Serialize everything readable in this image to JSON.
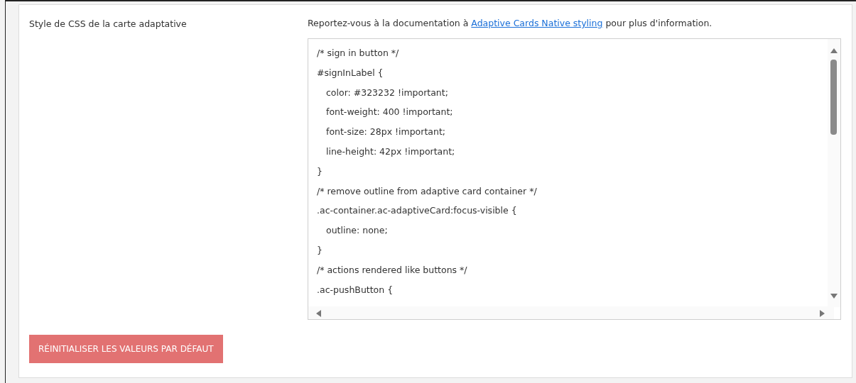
{
  "setting": {
    "label": "Style de CSS de la carte adaptative",
    "help": {
      "before": "Reportez-vous à la documentation à ",
      "link": "Adaptive Cards Native styling",
      "after": " pour plus d'information."
    },
    "code_lines": [
      {
        "text": "/* sign in button */",
        "indented": false
      },
      {
        "text": "#signInLabel {",
        "indented": false
      },
      {
        "text": "color: #323232 !important;",
        "indented": true
      },
      {
        "text": "font-weight: 400 !important;",
        "indented": true
      },
      {
        "text": "font-size: 28px !important;",
        "indented": true
      },
      {
        "text": "line-height: 42px !important;",
        "indented": true
      },
      {
        "text": "}",
        "indented": false
      },
      {
        "text": "/* remove outline from adaptive card container */",
        "indented": false
      },
      {
        "text": ".ac-container.ac-adaptiveCard:focus-visible {",
        "indented": false
      },
      {
        "text": "outline: none;",
        "indented": true
      },
      {
        "text": "}",
        "indented": false
      },
      {
        "text": "/* actions rendered like buttons */",
        "indented": false
      },
      {
        "text": ".ac-pushButton {",
        "indented": false
      }
    ]
  },
  "reset_button": "RÉINITIALISER LES VALEURS PAR DÉFAUT"
}
